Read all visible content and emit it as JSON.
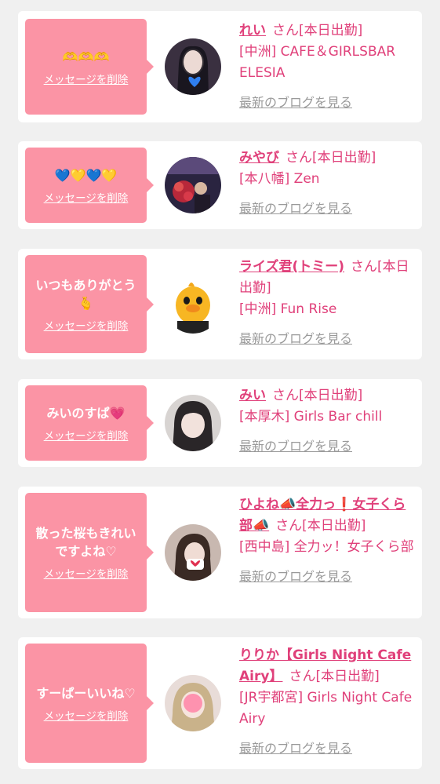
{
  "delete_label": "メッセージを削除",
  "san_label": "さん",
  "blog_label": "最新のブログを見る",
  "colors": {
    "bubble": "#fb94a5",
    "accent": "#e0407a",
    "muted": "#9a9a9a"
  },
  "cards": [
    {
      "message": "🫶🫶🫶",
      "name": "れい",
      "status": "[本日出勤]",
      "shop": "[中洲] CAFE＆GIRLSBAR ELESIA",
      "avatar": "portrait-dark-hair-heart"
    },
    {
      "message": "💙💛💙💛",
      "name": "みやび",
      "status": "[本日出勤]",
      "shop": "[本八幡] Zen",
      "avatar": "flower-bouquet-photo"
    },
    {
      "message": "いつもありがとう🫰",
      "name": "ライズ君(トミー)",
      "status": "[本日出勤]",
      "shop": "[中洲] Fun Rise",
      "avatar": "yellow-chick-mascot"
    },
    {
      "message": "みいのすぱ💗",
      "name": "みい",
      "status": "[本日出勤]",
      "shop": "[本厚木] Girls Bar chill",
      "avatar": "portrait-bangs"
    },
    {
      "message": "散った桜もきれいですよね♡",
      "name": "ひよね📣全力っ❗女子くら部📣",
      "status": "[本日出勤]",
      "shop": "[西中島] 全力ッ！女子くら部",
      "avatar": "portrait-heart-sticker"
    },
    {
      "message": "すーぱーいいね♡",
      "name": "りりか【Girls Night Cafe Airy】",
      "status": "[本日出勤]",
      "shop": "[JR宇都宮] Girls Night Cafe Airy",
      "avatar": "portrait-pink-blur"
    }
  ]
}
